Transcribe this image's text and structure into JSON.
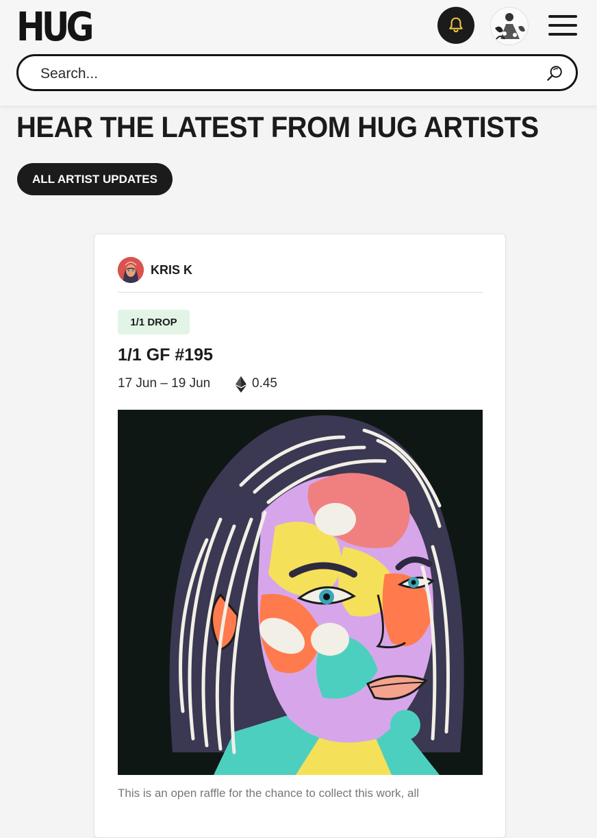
{
  "header": {
    "logo_text": "HUG",
    "search_placeholder": "Search..."
  },
  "section": {
    "title": "HEAR THE LATEST FROM HUG ARTISTS",
    "button_label": "ALL ARTIST UPDATES"
  },
  "card": {
    "artist_name": "KRIS K",
    "badge": "1/1 DROP",
    "title": "1/1 GF #195",
    "dates": "17 Jun – 19 Jun",
    "price": "0.45",
    "description": "This is an open raffle for the chance to collect this work, all"
  },
  "colors": {
    "dark": "#1b1b1b",
    "badge_bg": "#e2f4e6",
    "bell_accent": "#f5c542"
  }
}
